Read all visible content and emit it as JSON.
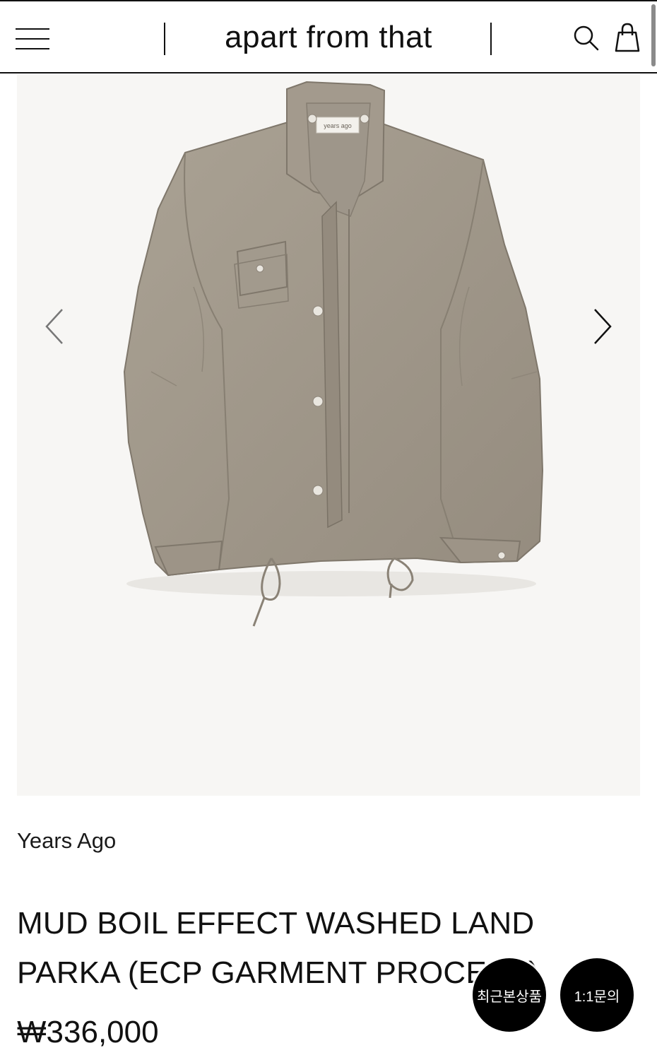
{
  "header": {
    "logo": "apart from that",
    "icons": [
      "menu-icon",
      "search-icon",
      "shopping-bag-icon"
    ]
  },
  "gallery": {
    "image_label": "years ago",
    "prev_icon": "chevron-left-icon",
    "next_icon": "chevron-right-icon"
  },
  "product": {
    "brand": "Years Ago",
    "name": "MUD BOIL EFFECT WASHED LAND PARKA (ECP GARMENT PROCESS)",
    "price": "₩336,000"
  },
  "floating": {
    "recent_label": "최근본상품",
    "inquiry_label": "1:1문의"
  },
  "colors": {
    "background": "#ffffff",
    "image_bg": "#f7f6f4",
    "jacket": "#a59c8f",
    "text": "#111111"
  }
}
